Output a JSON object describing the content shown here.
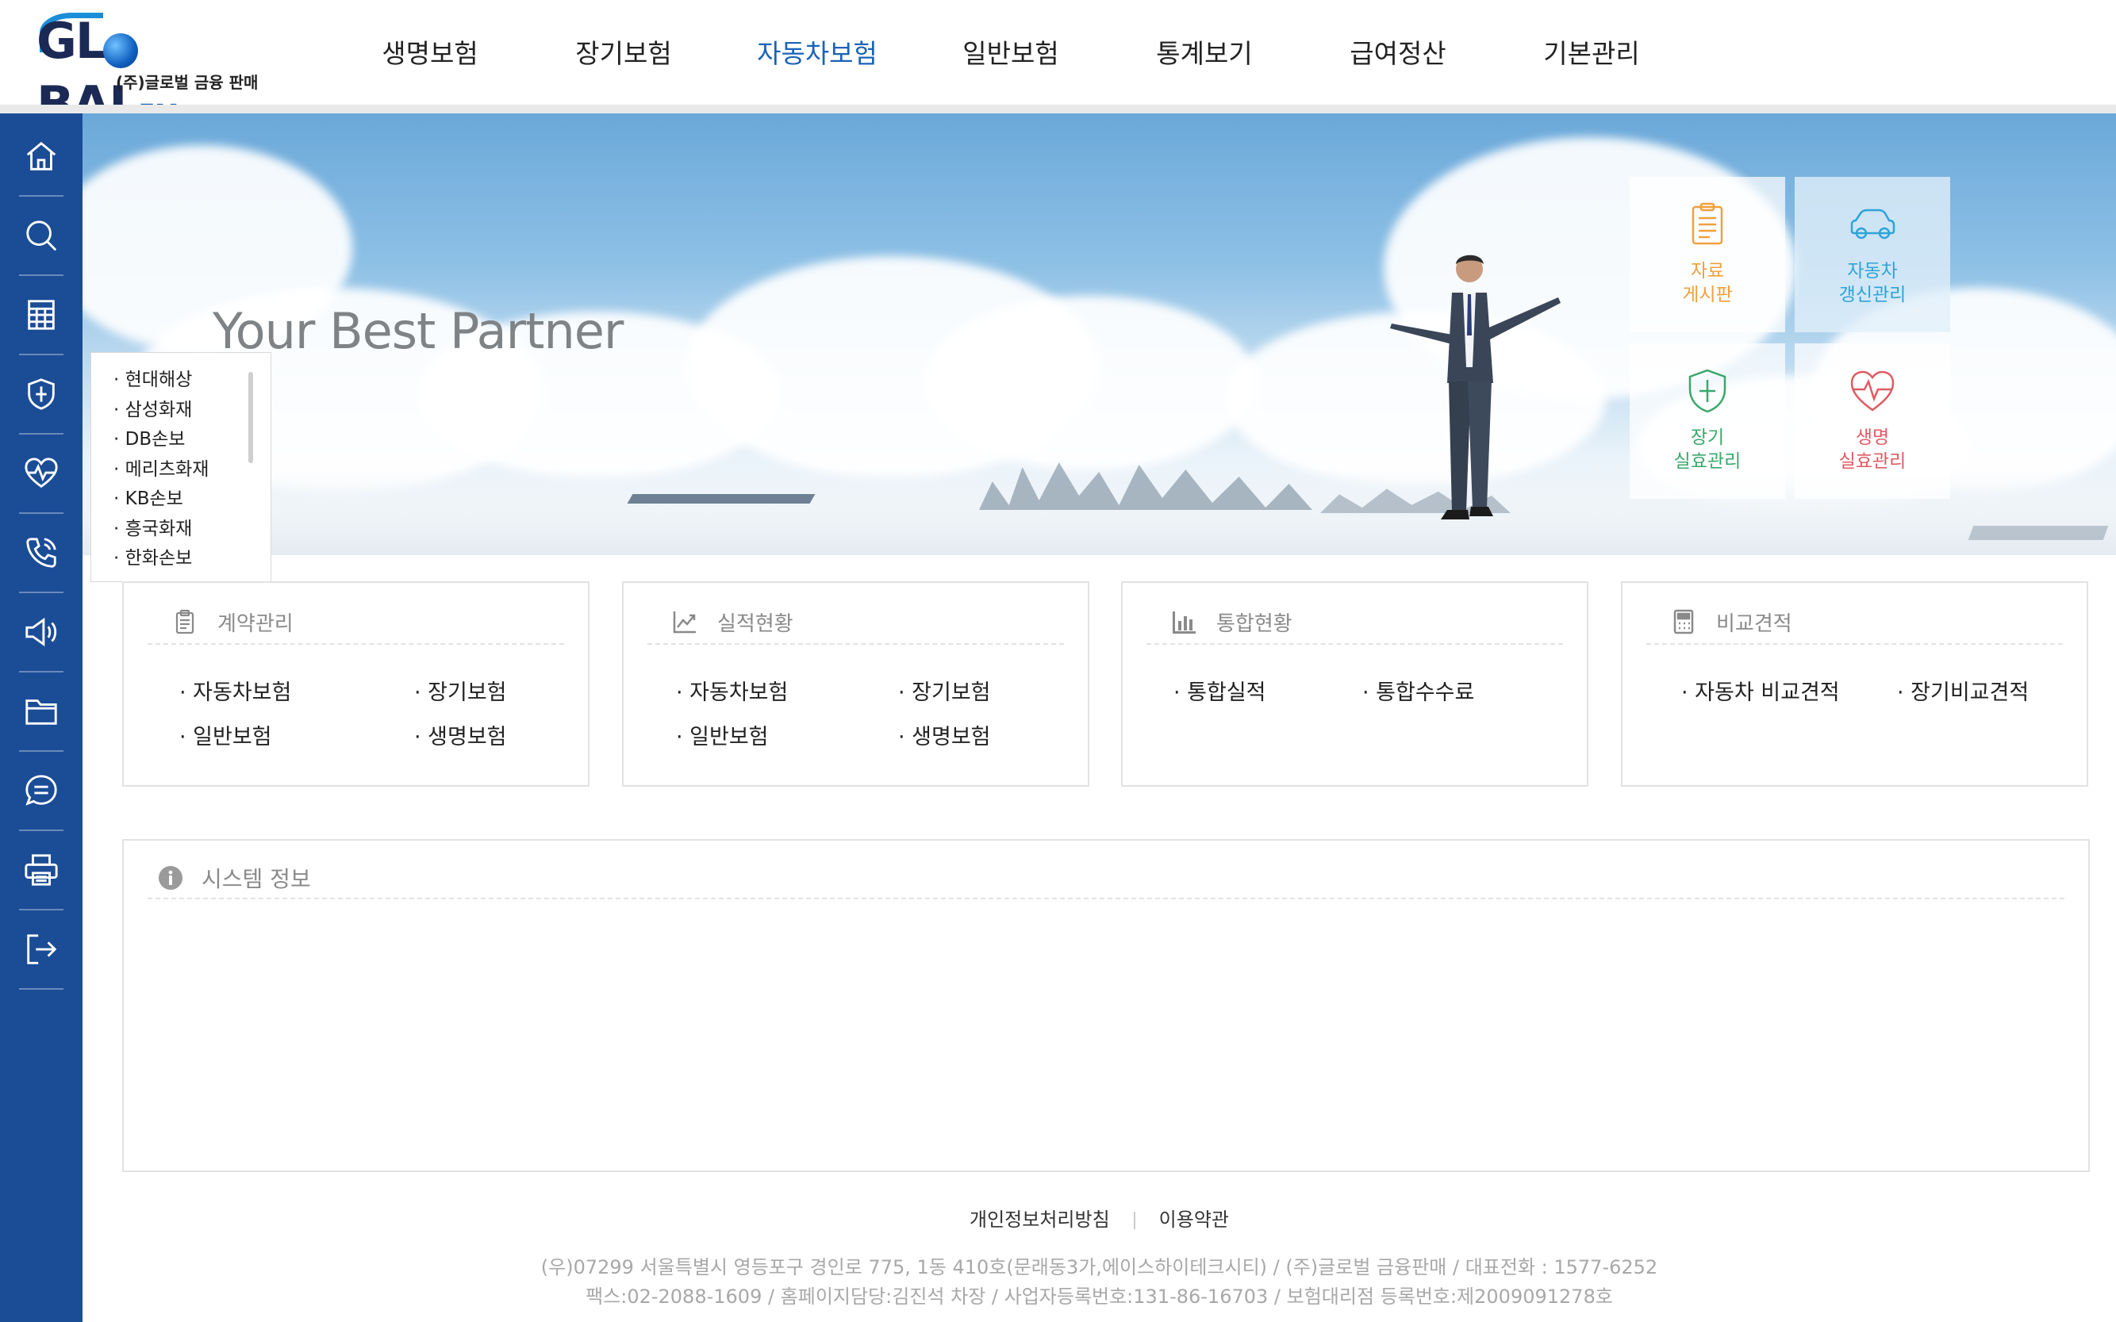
{
  "logo": {
    "word": "GL",
    "word2": "BAL",
    "fm": "FM",
    "sub": "(주)글로벌 금융 판매"
  },
  "gnb": [
    {
      "label": "생명보험",
      "active": false
    },
    {
      "label": "장기보험",
      "active": false
    },
    {
      "label": "자동차보험",
      "active": true
    },
    {
      "label": "일반보험",
      "active": false
    },
    {
      "label": "통계보기",
      "active": false
    },
    {
      "label": "급여정산",
      "active": false
    },
    {
      "label": "기본관리",
      "active": false
    }
  ],
  "sidebar": [
    "home-icon",
    "search-icon",
    "calculator-icon",
    "shield-icon",
    "heartbeat-icon",
    "phone-icon",
    "megaphone-icon",
    "folder-icon",
    "chat-icon",
    "printer-icon",
    "logout-icon"
  ],
  "hero": {
    "title": "Your Best Partner"
  },
  "quick": {
    "board": {
      "label": "자료\n게시판",
      "color": "#f0a03c"
    },
    "car": {
      "label": "자동차\n갱신관리",
      "color": "#2fa3d8"
    },
    "long": {
      "label": "장기\n실효관리",
      "color": "#3aa86a"
    },
    "life": {
      "label": "생명\n실효관리",
      "color": "#e05a63"
    }
  },
  "insurers": [
    "· 현대해상",
    "· 삼성화재",
    "· DB손보",
    "· 메리츠화재",
    "· KB손보",
    "· 흥국화재",
    "· 한화손보"
  ],
  "cards": {
    "contract": {
      "title": "계약관리",
      "links": [
        "· 자동차보험",
        "· 장기보험",
        "· 일반보험",
        "· 생명보험"
      ]
    },
    "performance": {
      "title": "실적현황",
      "links": [
        "· 자동차보험",
        "· 장기보험",
        "· 일반보험",
        "· 생명보험"
      ]
    },
    "total": {
      "title": "통합현황",
      "links": [
        "· 통합실적",
        "· 통합수수료"
      ]
    },
    "compare": {
      "title": "비교견적",
      "links": [
        "· 자동차 비교견적",
        "· 장기비교견적"
      ]
    }
  },
  "system": {
    "title": "시스템 정보"
  },
  "footer": {
    "privacy": "개인정보처리방침",
    "terms": "이용약관",
    "address": "(우)07299 서울특별시 영등포구 경인로 775, 1동 410호(문래동3가,에이스하이테크시티) / (주)글로벌 금융판매 / 대표전화 : 1577-6252",
    "fax": "팩스:02-2088-1609 / 홈페이지담당:김진석 차장 / 사업자등록번호:131-86-16703 / 보험대리점 등록번호:제2009091278호"
  }
}
